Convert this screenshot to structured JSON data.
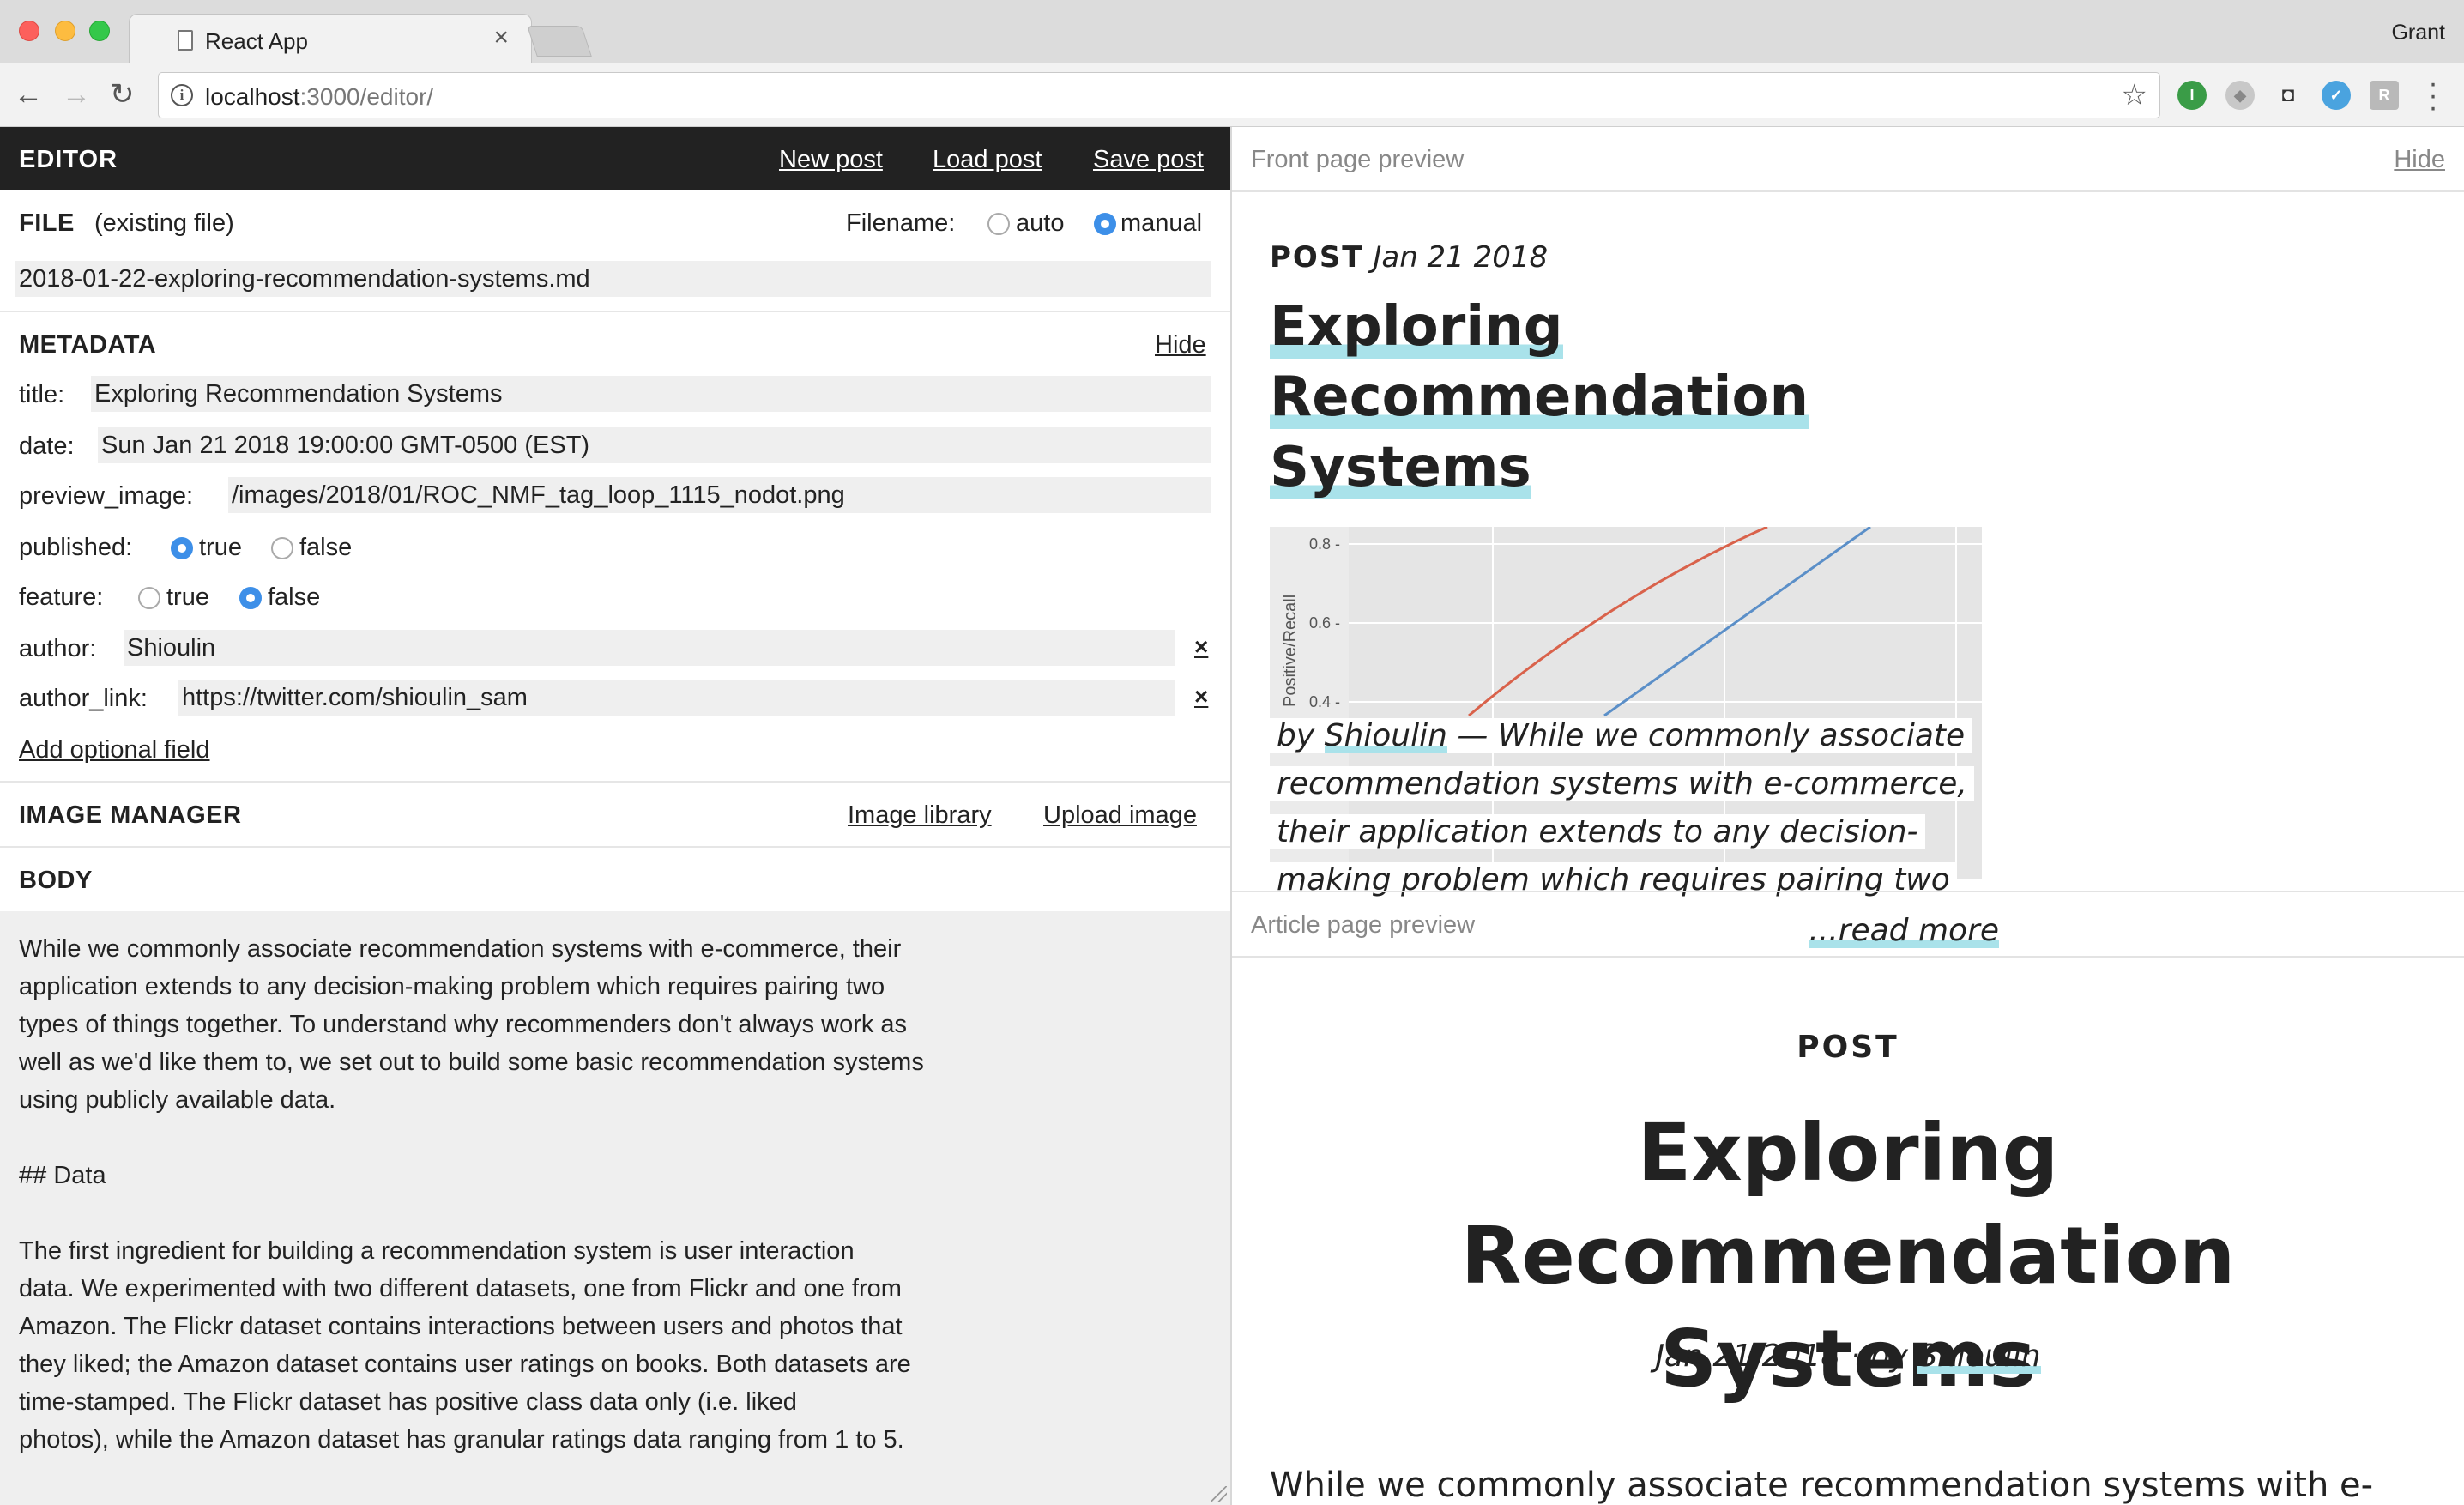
{
  "browser": {
    "tab_title": "React App",
    "user": "Grant",
    "url_host": "localhost",
    "url_path": ":3000/editor/"
  },
  "editor": {
    "title": "EDITOR",
    "actions": {
      "new_post": "New post",
      "load_post": "Load post",
      "save_post": "Save post"
    },
    "file": {
      "heading": "FILE",
      "status": "(existing file)",
      "filename_label": "Filename:",
      "opt_auto": "auto",
      "opt_manual": "manual",
      "filename_mode": "manual",
      "filename": "2018-01-22-exploring-recommendation-systems.md"
    },
    "metadata": {
      "heading": "METADATA",
      "hide": "Hide",
      "title_label": "title:",
      "title": "Exploring Recommendation Systems",
      "date_label": "date:",
      "date": "Sun Jan 21 2018 19:00:00 GMT-0500 (EST)",
      "preview_image_label": "preview_image:",
      "preview_image": "/images/2018/01/ROC_NMF_tag_loop_1115_nodot.png",
      "published_label": "published:",
      "published": true,
      "feature_label": "feature:",
      "feature": false,
      "opt_true": "true",
      "opt_false": "false",
      "author_label": "author:",
      "author": "Shioulin",
      "author_link_label": "author_link:",
      "author_link": "https://twitter.com/shioulin_sam",
      "remove": "×",
      "add_field": "Add optional field"
    },
    "image_manager": {
      "heading": "IMAGE MANAGER",
      "library": "Image library",
      "upload": "Upload image"
    },
    "body": {
      "heading": "BODY",
      "text": "While we commonly associate recommendation systems with e-commerce, their\napplication extends to any decision-making problem which requires pairing two\ntypes of things together. To understand why recommenders don't always work as\nwell as we'd like them to, we set out to build some basic recommendation systems\nusing publicly available data.\n\n## Data\n\nThe first ingredient for building a recommendation system is user interaction\ndata. We experimented with two different datasets, one from Flickr and one from\nAmazon. The Flickr dataset contains interactions between users and photos that\nthey liked; the Amazon dataset contains user ratings on books. Both datasets are\ntime-stamped. The Flickr dataset has positive class data only (i.e. liked\nphotos), while the Amazon dataset has granular ratings data ranging from 1 to 5."
    }
  },
  "preview": {
    "front_label": "Front page preview",
    "hide": "Hide",
    "card": {
      "kicker": "POST",
      "date": "Jan 21 2018",
      "title_line1": "Exploring",
      "title_line2": "Recommendation Systems",
      "chart_ylabel": "Positive/Recall",
      "chart_ticks": [
        "0.8 -",
        "0.6 -",
        "0.4 -"
      ],
      "by": "by",
      "author": "Shioulin",
      "excerpt": "— While we commonly associate recommendation systems with e-commerce, their application extends to any decision-making problem which requires pairing two",
      "read_more": "...read more"
    },
    "article_label": "Article page preview",
    "article": {
      "kicker": "POST",
      "title": "Exploring Recommendation Systems",
      "date": "Jan 21 2018 ·",
      "by": "by",
      "author": "Shioulin",
      "body_start": "While we commonly associate recommendation systems with e-"
    }
  }
}
